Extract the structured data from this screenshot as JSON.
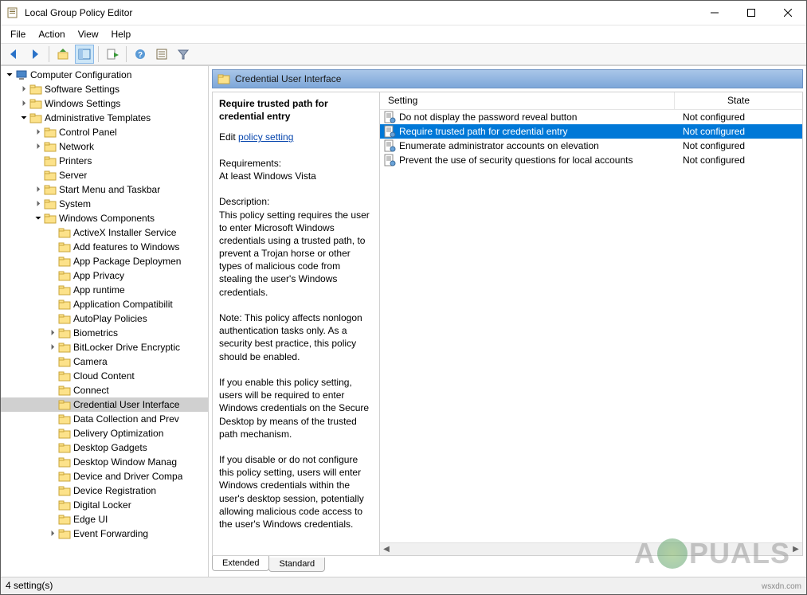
{
  "window": {
    "title": "Local Group Policy Editor"
  },
  "menubar": [
    "File",
    "Action",
    "View",
    "Help"
  ],
  "tree": [
    {
      "indent": 0,
      "exp": "open",
      "icon": "pc",
      "label": "Computer Configuration"
    },
    {
      "indent": 1,
      "exp": "closed",
      "icon": "folder",
      "label": "Software Settings"
    },
    {
      "indent": 1,
      "exp": "closed",
      "icon": "folder",
      "label": "Windows Settings"
    },
    {
      "indent": 1,
      "exp": "open",
      "icon": "folder",
      "label": "Administrative Templates"
    },
    {
      "indent": 2,
      "exp": "closed",
      "icon": "folder",
      "label": "Control Panel"
    },
    {
      "indent": 2,
      "exp": "closed",
      "icon": "folder",
      "label": "Network"
    },
    {
      "indent": 2,
      "exp": "none",
      "icon": "folder",
      "label": "Printers"
    },
    {
      "indent": 2,
      "exp": "none",
      "icon": "folder",
      "label": "Server"
    },
    {
      "indent": 2,
      "exp": "closed",
      "icon": "folder",
      "label": "Start Menu and Taskbar"
    },
    {
      "indent": 2,
      "exp": "closed",
      "icon": "folder",
      "label": "System"
    },
    {
      "indent": 2,
      "exp": "open",
      "icon": "folder",
      "label": "Windows Components"
    },
    {
      "indent": 3,
      "exp": "none",
      "icon": "folder",
      "label": "ActiveX Installer Service"
    },
    {
      "indent": 3,
      "exp": "none",
      "icon": "folder",
      "label": "Add features to Windows"
    },
    {
      "indent": 3,
      "exp": "none",
      "icon": "folder",
      "label": "App Package Deploymen"
    },
    {
      "indent": 3,
      "exp": "none",
      "icon": "folder",
      "label": "App Privacy"
    },
    {
      "indent": 3,
      "exp": "none",
      "icon": "folder",
      "label": "App runtime"
    },
    {
      "indent": 3,
      "exp": "none",
      "icon": "folder",
      "label": "Application Compatibilit"
    },
    {
      "indent": 3,
      "exp": "none",
      "icon": "folder",
      "label": "AutoPlay Policies"
    },
    {
      "indent": 3,
      "exp": "closed",
      "icon": "folder",
      "label": "Biometrics"
    },
    {
      "indent": 3,
      "exp": "closed",
      "icon": "folder",
      "label": "BitLocker Drive Encryptic"
    },
    {
      "indent": 3,
      "exp": "none",
      "icon": "folder",
      "label": "Camera"
    },
    {
      "indent": 3,
      "exp": "none",
      "icon": "folder",
      "label": "Cloud Content"
    },
    {
      "indent": 3,
      "exp": "none",
      "icon": "folder",
      "label": "Connect"
    },
    {
      "indent": 3,
      "exp": "none",
      "icon": "folder",
      "label": "Credential User Interface",
      "selected": true
    },
    {
      "indent": 3,
      "exp": "none",
      "icon": "folder",
      "label": "Data Collection and Prev"
    },
    {
      "indent": 3,
      "exp": "none",
      "icon": "folder",
      "label": "Delivery Optimization"
    },
    {
      "indent": 3,
      "exp": "none",
      "icon": "folder",
      "label": "Desktop Gadgets"
    },
    {
      "indent": 3,
      "exp": "none",
      "icon": "folder",
      "label": "Desktop Window Manag"
    },
    {
      "indent": 3,
      "exp": "none",
      "icon": "folder",
      "label": "Device and Driver Compa"
    },
    {
      "indent": 3,
      "exp": "none",
      "icon": "folder",
      "label": "Device Registration"
    },
    {
      "indent": 3,
      "exp": "none",
      "icon": "folder",
      "label": "Digital Locker"
    },
    {
      "indent": 3,
      "exp": "none",
      "icon": "folder",
      "label": "Edge UI"
    },
    {
      "indent": 3,
      "exp": "closed",
      "icon": "folder",
      "label": "Event Forwarding"
    }
  ],
  "header_band": "Credential User Interface",
  "description": {
    "title": "Require trusted path for credential entry",
    "edit_prefix": "Edit ",
    "edit_link": "policy setting",
    "requirements_label": "Requirements:",
    "requirements_text": "At least Windows Vista",
    "description_label": "Description:",
    "paragraphs": [
      "This policy setting requires the user to enter Microsoft Windows credentials using a trusted path, to prevent a Trojan horse or other types of malicious code from stealing the user's Windows credentials.",
      "Note: This policy affects nonlogon authentication tasks only. As a security best practice, this policy should be enabled.",
      "If you enable this policy setting, users will be required to enter Windows credentials on the Secure Desktop by means of the trusted path mechanism.",
      "If you disable or do not configure this policy setting, users will enter Windows credentials within the user's desktop session, potentially allowing malicious code access to the user's Windows credentials."
    ]
  },
  "columns": {
    "setting": "Setting",
    "state": "State"
  },
  "settings": [
    {
      "name": "Do not display the password reveal button",
      "state": "Not configured"
    },
    {
      "name": "Require trusted path for credential entry",
      "state": "Not configured",
      "selected": true
    },
    {
      "name": "Enumerate administrator accounts on elevation",
      "state": "Not configured"
    },
    {
      "name": "Prevent the use of security questions for local accounts",
      "state": "Not configured"
    }
  ],
  "tabs": {
    "extended": "Extended",
    "standard": "Standard"
  },
  "statusbar": "4 setting(s)",
  "watermark_text": "A  PUALS",
  "source_site": "wsxdn.com"
}
